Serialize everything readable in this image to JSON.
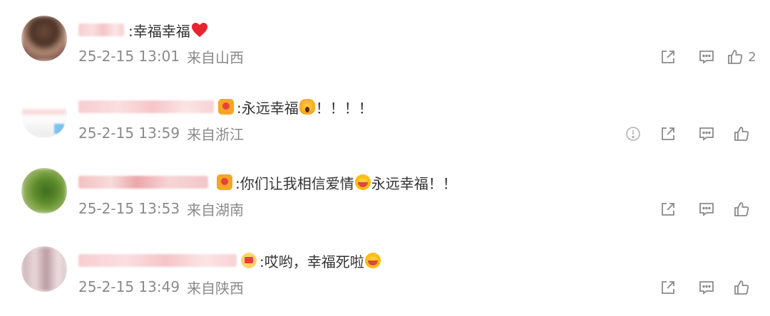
{
  "comments": [
    {
      "comment_text": ":幸福幸福",
      "date": "25-2-15 13:01",
      "location": "来自山西",
      "like_count": "2"
    },
    {
      "comment_text_a": ":永远幸福",
      "comment_text_b": "！！！！",
      "date": "25-2-15 13:59",
      "location": "来自浙江"
    },
    {
      "comment_text_a": ":你们让我相信爱情",
      "comment_text_b": "永远幸福！！",
      "date": "25-2-15 13:53",
      "location": "来自湖南"
    },
    {
      "comment_text_a": ":哎哟，幸福死啦",
      "date": "25-2-15 13:49",
      "location": "来自陕西"
    }
  ],
  "icons": {
    "share": "share-icon",
    "comment": "comment-icon",
    "like": "thumbs-up-icon",
    "report": "report-icon"
  },
  "colors": {
    "text": "#333333",
    "meta": "#8a8a8a",
    "heart": "#e8232f"
  }
}
